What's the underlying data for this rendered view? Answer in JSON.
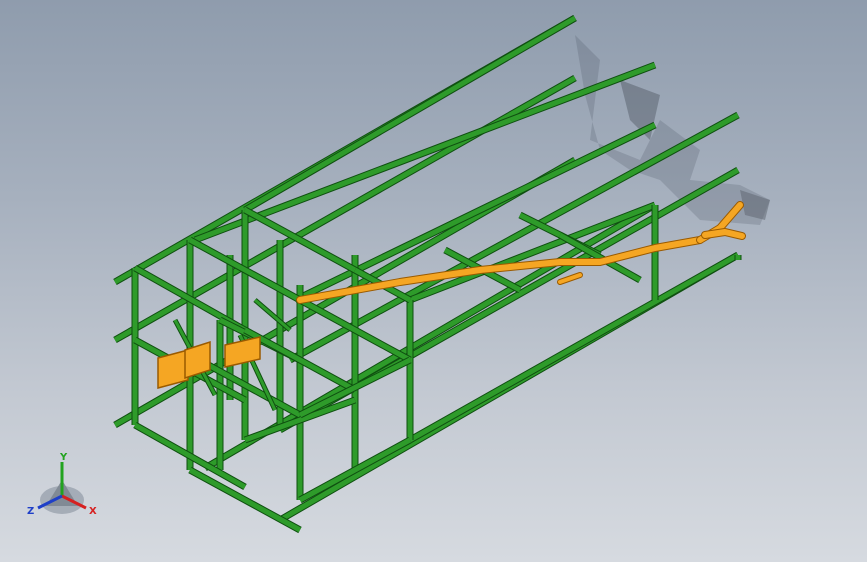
{
  "viewport": {
    "name": "cad-3d-viewport",
    "background_top": "#8f9cad",
    "background_bottom": "#d6dae0"
  },
  "model": {
    "frame_color": "#2e9b2a",
    "frame_edge_color": "#0f4f10",
    "pipe_color": "#f5a623",
    "pipe_edge_color": "#9a5a00",
    "shadow_color": "#3a4250"
  },
  "triad": {
    "x_label": "X",
    "y_label": "Y",
    "z_label": "Z",
    "x_color": "#d62020",
    "y_color": "#22a31f",
    "z_color": "#1e3fc8"
  }
}
